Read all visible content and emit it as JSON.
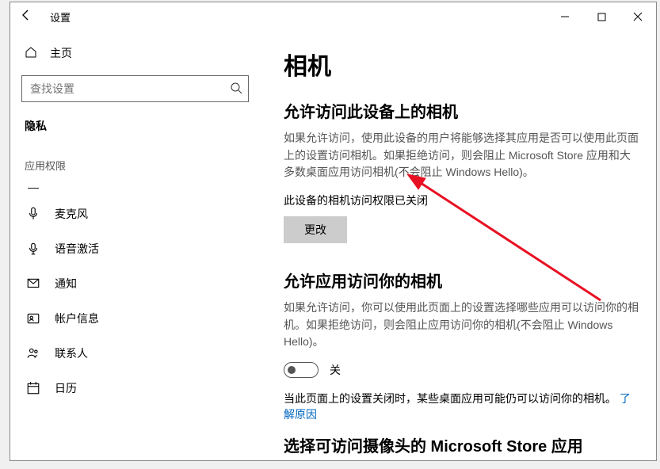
{
  "window": {
    "title": "设置"
  },
  "sidebar": {
    "home": "主页",
    "search_placeholder": "查找设置",
    "section": "隐私",
    "group": "应用权限",
    "items": [
      {
        "label": "麦克风"
      },
      {
        "label": "语音激活"
      },
      {
        "label": "通知"
      },
      {
        "label": "帐户信息"
      },
      {
        "label": "联系人"
      },
      {
        "label": "日历"
      }
    ]
  },
  "content": {
    "page_title": "相机",
    "section1_title": "允许访问此设备上的相机",
    "section1_desc": "如果允许访问，使用此设备的用户将能够选择其应用是否可以使用此页面上的设置访问相机。如果拒绝访问，则会阻止 Microsoft Store 应用和大多数桌面应用访问相机(不会阻止 Windows Hello)。",
    "status_text": "此设备的相机访问权限已关闭",
    "change_button": "更改",
    "section2_title": "允许应用访问你的相机",
    "section2_desc": "如果允许访问，你可以使用此页面上的设置选择哪些应用可以访问你的相机。如果拒绝访问，则会阻止应用访问你的相机(不会阻止 Windows Hello)。",
    "toggle_state": "关",
    "note_prefix": "当此页面上的设置关闭时，某些桌面应用可能仍可以访问你的相机。",
    "note_link": "了解原因",
    "section3_title": "选择可访问摄像头的 Microsoft Store 应用"
  }
}
